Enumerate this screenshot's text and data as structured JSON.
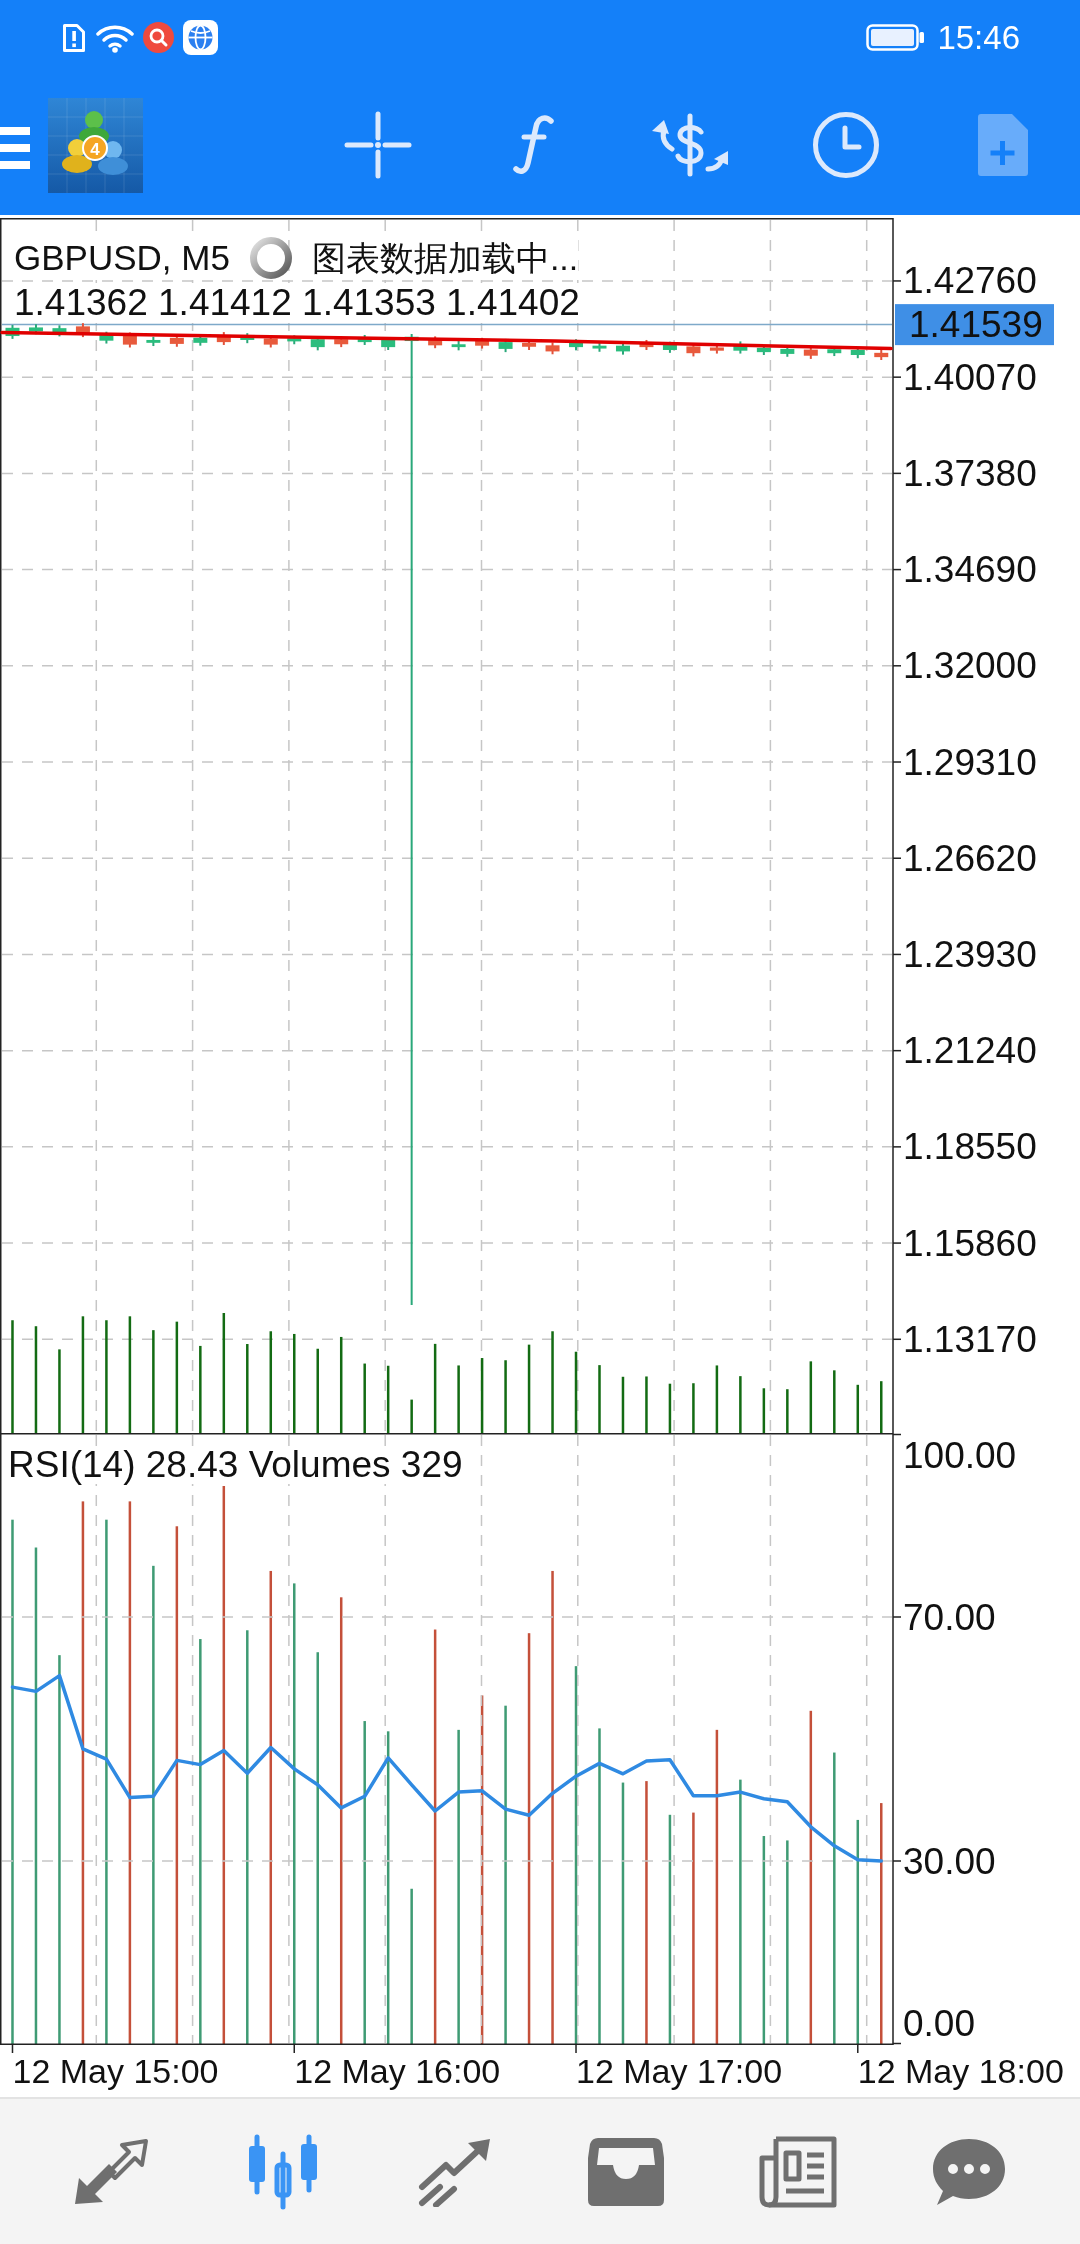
{
  "status_bar": {
    "time": "15:46"
  },
  "toolbar": {
    "logo_badge": "4",
    "buttons": [
      {
        "disabled": false
      },
      {
        "disabled": false
      },
      {
        "disabled": false
      },
      {
        "disabled": false
      },
      {
        "disabled": true
      }
    ]
  },
  "main_chart": {
    "symbol": "GBPUSD, M5",
    "status": "图表数据加载中...",
    "ohlc_readout": "1.41362 1.41412 1.41353 1.41402",
    "chart_data": {
      "type": "candlestick",
      "grid": true,
      "ylim": [
        1.1055,
        1.4452
      ],
      "yticks": [
        {
          "value": 1.4276,
          "label": "1.42760"
        },
        {
          "value": 1.4007,
          "label": "1.40070"
        },
        {
          "value": 1.3738,
          "label": "1.37380"
        },
        {
          "value": 1.3469,
          "label": "1.34690"
        },
        {
          "value": 1.32,
          "label": "1.32000"
        },
        {
          "value": 1.2931,
          "label": "1.29310"
        },
        {
          "value": 1.2662,
          "label": "1.26620"
        },
        {
          "value": 1.2393,
          "label": "1.23930"
        },
        {
          "value": 1.2124,
          "label": "1.21240"
        },
        {
          "value": 1.1855,
          "label": "1.18550"
        },
        {
          "value": 1.1586,
          "label": "1.15860"
        },
        {
          "value": 1.1317,
          "label": "1.13170"
        }
      ],
      "categories": [
        null,
        null,
        null,
        null,
        null,
        null,
        null,
        null,
        null,
        null,
        null,
        null,
        null,
        null,
        null,
        null,
        null,
        null,
        null,
        null,
        null,
        null,
        null,
        null,
        null,
        null,
        null,
        null,
        null,
        null,
        null,
        null,
        null,
        null,
        null,
        null,
        null,
        null
      ],
      "ohlc": [
        [
          1.4122,
          1.4153,
          1.4114,
          1.4145
        ],
        [
          1.4135,
          1.4155,
          1.4127,
          1.4146
        ],
        [
          1.413,
          1.4152,
          1.4121,
          1.4144
        ],
        [
          1.4149,
          1.4158,
          1.4119,
          1.4127
        ],
        [
          1.4109,
          1.4134,
          1.4101,
          1.4126
        ],
        [
          1.4123,
          1.4132,
          1.409,
          1.4098
        ],
        [
          1.4103,
          1.412,
          1.4094,
          1.4111
        ],
        [
          1.4117,
          1.4125,
          1.4092,
          1.41
        ],
        [
          1.4103,
          1.4126,
          1.4095,
          1.4117
        ],
        [
          1.4125,
          1.4133,
          1.4097,
          1.4105
        ],
        [
          1.4111,
          1.413,
          1.4102,
          1.4122
        ],
        [
          1.4115,
          1.4124,
          1.409,
          1.4098
        ],
        [
          1.4107,
          1.4124,
          1.4099,
          1.4116
        ],
        [
          1.4091,
          1.4121,
          1.4082,
          1.4113
        ],
        [
          1.4113,
          1.4122,
          1.4091,
          1.4099
        ],
        [
          1.4105,
          1.4125,
          1.4097,
          1.4116
        ],
        [
          1.4091,
          1.4119,
          1.4083,
          1.4111
        ],
        [
          1.4108,
          1.4128,
          1.1413,
          1.412
        ],
        [
          1.4113,
          1.4121,
          1.4088,
          1.4096
        ],
        [
          1.4091,
          1.4108,
          1.4082,
          1.4099
        ],
        [
          1.4109,
          1.4117,
          1.4087,
          1.4095
        ],
        [
          1.4086,
          1.4114,
          1.4077,
          1.4105
        ],
        [
          1.4103,
          1.4111,
          1.4083,
          1.4092
        ],
        [
          1.4096,
          1.4104,
          1.4071,
          1.4079
        ],
        [
          1.4091,
          1.4113,
          1.4082,
          1.4105
        ],
        [
          1.4087,
          1.4104,
          1.4078,
          1.4095
        ],
        [
          1.4079,
          1.4104,
          1.407,
          1.4095
        ],
        [
          1.4103,
          1.4111,
          1.4083,
          1.4091
        ],
        [
          1.4083,
          1.4106,
          1.4075,
          1.4097
        ],
        [
          1.4093,
          1.4102,
          1.4065,
          1.4074
        ],
        [
          1.409,
          1.4098,
          1.4073,
          1.4081
        ],
        [
          1.4081,
          1.4107,
          1.4073,
          1.4098
        ],
        [
          1.4077,
          1.4097,
          1.4069,
          1.4089
        ],
        [
          1.4072,
          1.4095,
          1.4064,
          1.4086
        ],
        [
          1.4084,
          1.4092,
          1.4058,
          1.4067
        ],
        [
          1.4074,
          1.4094,
          1.4066,
          1.4085
        ],
        [
          1.4069,
          1.4091,
          1.406,
          1.4083
        ],
        [
          1.4075,
          1.4083,
          1.4055,
          1.4063
        ]
      ],
      "ref_lines": [
        {
          "axis": "y",
          "value": 1.41539,
          "label": "1.41539"
        }
      ]
    }
  },
  "indicator_pane": {
    "legend": "RSI(14) 28.43 Volumes 329",
    "scale_max_label": "100.00",
    "scale_min_label": "0.00",
    "chart_data": {
      "type": "line",
      "grid": true,
      "ylim": [
        0,
        100
      ],
      "yticks": [
        {
          "value": 70,
          "label": "70.00"
        },
        {
          "value": 30,
          "label": "30.00"
        }
      ],
      "series": [
        {
          "color": "#2f8ae2",
          "values": [
            58.5,
            57.8,
            60.4,
            48.4,
            46.7,
            40.4,
            40.6,
            46.5,
            45.8,
            48.1,
            44.4,
            48.6,
            45.1,
            42.5,
            38.7,
            40.6,
            46.9,
            42.5,
            38.2,
            41.3,
            41.5,
            38.5,
            37.5,
            41.1,
            43.9,
            46.0,
            44.3,
            46.4,
            46.6,
            40.7,
            40.7,
            41.3,
            40.2,
            39.7,
            35.6,
            32.5,
            30.2,
            30.0
          ]
        }
      ]
    }
  },
  "time_axis": {
    "labels": [
      "12 May 15:00",
      "12 May 16:00",
      "12 May 17:00",
      "12 May 18:00"
    ]
  },
  "bottom_nav": [
    {
      "selected": false
    },
    {
      "selected": true
    },
    {
      "selected": false
    },
    {
      "selected": false
    },
    {
      "selected": false
    },
    {
      "selected": false
    }
  ]
}
